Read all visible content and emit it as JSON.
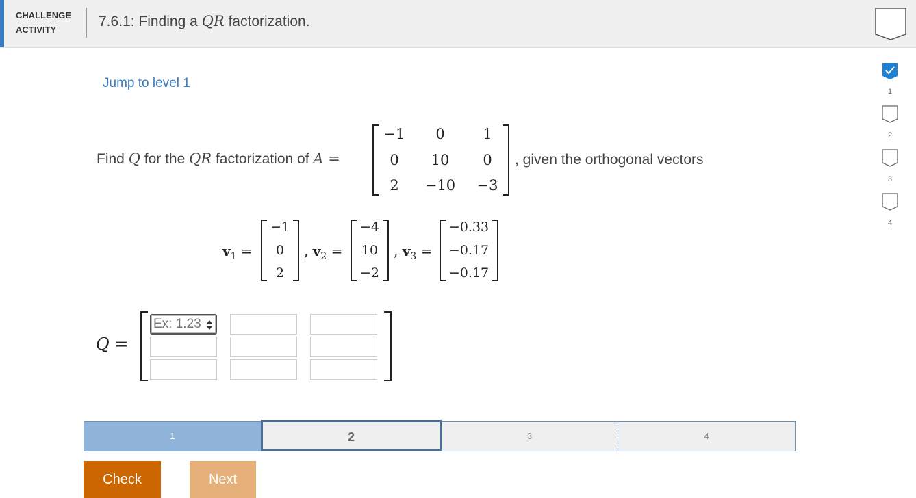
{
  "header": {
    "tag_line1": "CHALLENGE",
    "tag_line2": "ACTIVITY",
    "title_prefix": "7.6.1: Finding a ",
    "title_math": "QR",
    "title_suffix": " factorization."
  },
  "jump_link": "Jump to level 1",
  "problem": {
    "lead": "Find ",
    "q_var": "Q",
    "mid": " for the ",
    "qr_var": "QR",
    "mid2": " factorization of ",
    "a_var": "A",
    "eq": " =",
    "trail": ", given the orthogonal vectors",
    "matrix_A": [
      [
        "−1",
        "0",
        "1"
      ],
      [
        "0",
        "10",
        "0"
      ],
      [
        "2",
        "−10",
        "−3"
      ]
    ]
  },
  "vectors": [
    {
      "label": "v",
      "sub": "1",
      "values": [
        "−1",
        "0",
        "2"
      ]
    },
    {
      "label": "v",
      "sub": "2",
      "values": [
        "−4",
        "10",
        "−2"
      ]
    },
    {
      "label": "v",
      "sub": "3",
      "values": [
        "−0.33",
        "−0.17",
        "−0.17"
      ]
    }
  ],
  "answer": {
    "label": "Q",
    "eq": " =",
    "placeholder": "Ex: 1.23"
  },
  "levels": {
    "items": [
      "1",
      "2",
      "3",
      "4"
    ],
    "current": 2,
    "completed": [
      1
    ]
  },
  "buttons": {
    "check": "Check",
    "next": "Next"
  },
  "sidebar": {
    "items": [
      {
        "num": "1",
        "completed": true
      },
      {
        "num": "2",
        "completed": false
      },
      {
        "num": "3",
        "completed": false
      },
      {
        "num": "4",
        "completed": false
      }
    ]
  },
  "colors": {
    "accent": "#3a7cc1",
    "check_button": "#cc6600",
    "next_button": "#e6b07a",
    "level_done": "#90b4da"
  }
}
